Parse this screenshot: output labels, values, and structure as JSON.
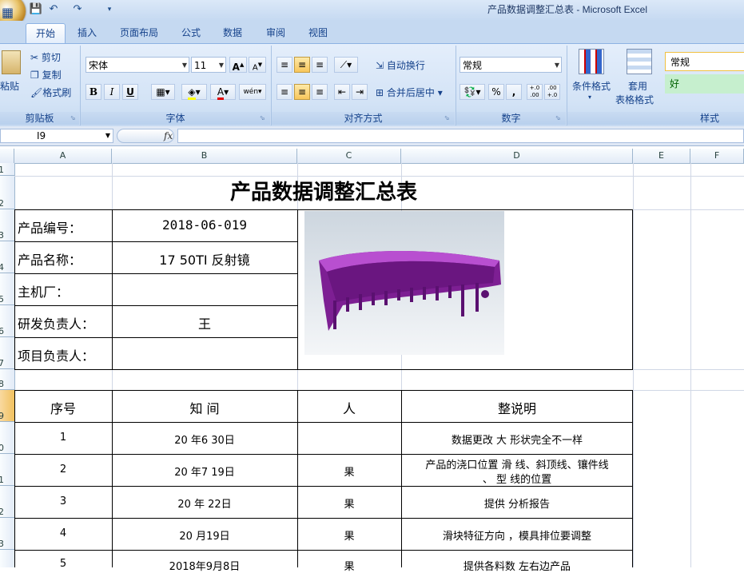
{
  "window": {
    "title": "产品数据调整汇总表 - Microsoft Excel"
  },
  "tabs": [
    "开始",
    "插入",
    "页面布局",
    "公式",
    "数据",
    "审阅",
    "视图"
  ],
  "ribbon": {
    "clipboard": {
      "paste": "粘贴",
      "cut": "剪切",
      "copy": "复制",
      "format_painter": "格式刷",
      "label": "剪贴板"
    },
    "font": {
      "name": "宋体",
      "size": "11",
      "bold": "B",
      "italic": "I",
      "underline": "U",
      "label": "字体"
    },
    "alignment": {
      "wrap": "自动换行",
      "merge": "合并后居中",
      "label": "对齐方式"
    },
    "number": {
      "format": "常规",
      "percent": "%",
      "comma": ",",
      "inc": "+.0 .00",
      "dec": ".00 +.0",
      "label": "数字"
    },
    "styles": {
      "conditional": "条件格式",
      "table_l1": "套用",
      "table_l2": "表格格式",
      "style_normal": "常规",
      "style_good": "好",
      "label": "样式"
    }
  },
  "formula_bar": {
    "name_box": "I9",
    "fx": "fx",
    "value": ""
  },
  "columns": [
    "A",
    "B",
    "C",
    "D",
    "E",
    "F"
  ],
  "rows": [
    "1",
    "2",
    "3",
    "4",
    "5",
    "6",
    "7",
    "8",
    "9",
    "0",
    "1",
    "2",
    "3"
  ],
  "sheet": {
    "title": "产品数据调整汇总表",
    "info": [
      {
        "label": "产品编号：",
        "value": "2018-06-019"
      },
      {
        "label": "产品名称：",
        "value": "17 50TI  反射镜"
      },
      {
        "label": "主机厂：",
        "value": ""
      },
      {
        "label": "研发负责人：",
        "value": "王"
      },
      {
        "label": "项目负责人：",
        "value": ""
      }
    ],
    "headers": [
      "序号",
      "知  间",
      "人",
      "整说明"
    ],
    "records": [
      {
        "no": "1",
        "date": "20  年6  30日",
        "person": "",
        "note": "数据更改  大  形状完全不一样"
      },
      {
        "no": "2",
        "date": "20  年7  19日",
        "person": "果",
        "note": "产品的浇口位置  滑  线、斜顶线、镶件线",
        "note2": "、  型  线的位置"
      },
      {
        "no": "3",
        "date": "20  年   22日",
        "person": "果",
        "note": "提供  分析报告"
      },
      {
        "no": "4",
        "date": "20   月19日",
        "person": "果",
        "note": "滑块特征方向  ，模具排位要调整"
      },
      {
        "no": "5",
        "date": "2018年9月8日",
        "person": "果",
        "note": "提供各料数   左右边产品"
      }
    ]
  },
  "colors": {
    "ribbon": "#dbe8f8",
    "selected_row": "#f1c15f",
    "part": "#8b1fa0"
  }
}
